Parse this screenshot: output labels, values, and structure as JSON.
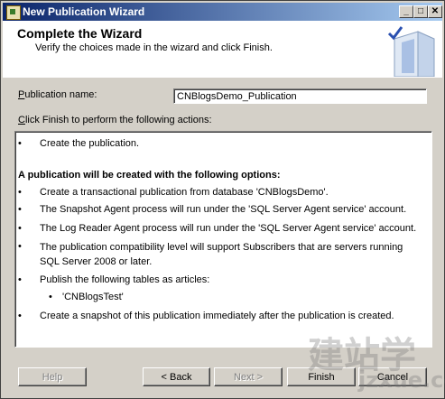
{
  "window": {
    "title": "New Publication Wizard",
    "controls": {
      "minimize": "_",
      "maximize": "□",
      "close": "✕"
    }
  },
  "header": {
    "title": "Complete the Wizard",
    "subtitle": "Verify the choices made in the wizard and click Finish."
  },
  "publication": {
    "label_prefix": "P",
    "label_rest": "ublication name:",
    "value": "CNBlogsDemo_Publication"
  },
  "actions_label": {
    "prefix": "C",
    "rest": "lick Finish to perform the following actions:"
  },
  "actions": {
    "first_item": "Create the publication.",
    "heading": "A publication will be created with the following options:",
    "items": [
      "Create a transactional publication from database 'CNBlogsDemo'.",
      "The Snapshot Agent process will run under the 'SQL Server Agent service' account.",
      "The Log Reader Agent process will run under the 'SQL Server Agent service' account.",
      "The publication compatibility level will support Subscribers that are servers running SQL Server 2008 or later.",
      "Publish the following tables as articles:"
    ],
    "article": "'CNBlogsTest'",
    "last_item": "Create a snapshot of this publication immediately after the publication is created.",
    "bullet": "•"
  },
  "buttons": {
    "help": "Help",
    "back": "< Back",
    "next": "Next >",
    "finish": "Finish",
    "cancel": "Cancel"
  },
  "watermark": {
    "text": "建站学",
    "url": "jzxue.com"
  }
}
